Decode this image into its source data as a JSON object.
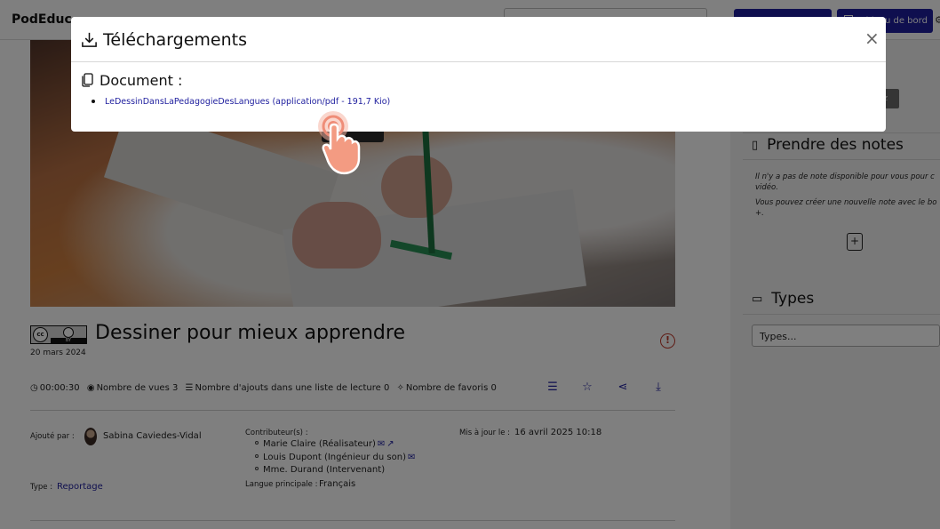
{
  "header": {
    "brand": "PodEduc",
    "dashboard_label": "Tableau de bord"
  },
  "video": {
    "title": "Dessiner pour mieux apprendre",
    "date": "20 mars 2024",
    "license_text": "cc",
    "license_by": "BY",
    "duration": "00:00:30",
    "views_label": "Nombre de vues 3",
    "playlist_adds_label": "Nombre d'ajouts dans une liste de lecture 0",
    "favorites_label": "Nombre de favoris 0"
  },
  "details": {
    "added_by_label": "Ajouté par :",
    "added_by_name": "Sabina Caviedes-Vidal",
    "contributors_label": "Contributeur(s) :",
    "contributors": [
      "Marie Claire (Réalisateur)",
      "Louis Dupont (Ingénieur du son)",
      "Mme. Durand (Intervenant)"
    ],
    "updated_label": "Mis à jour le :",
    "updated_value": "16 avril 2025 10:18",
    "type_label": "Type :",
    "type_value": "Reportage",
    "language_label": "Langue principale :",
    "language_value": "Français"
  },
  "sidebar": {
    "tab_label": "iz",
    "notes_title": "Prendre des notes",
    "notes_empty_line1": "Il n'y a pas de note disponible pour vous pour c",
    "notes_empty_line2": "vidéo.",
    "notes_create_line1": "Vous pouvez créer une nouvelle note avec le bo",
    "notes_create_line2": "+.",
    "types_title": "Types",
    "types_placeholder": "Types..."
  },
  "modal": {
    "title": "Téléchargements",
    "section_label": "Document :",
    "file_link": "LeDessinDansLaPedagogieDesLangues (application/pdf - 191,7 Kio)",
    "close_symbol": "×"
  },
  "colors": {
    "accent": "#1e1e9e",
    "alert": "#c0392b",
    "cursor": "#f39b82"
  },
  "icons": {
    "download": "download-icon",
    "close": "close-icon",
    "document": "document-icon",
    "hand_cursor": "hand-pointer-icon"
  }
}
